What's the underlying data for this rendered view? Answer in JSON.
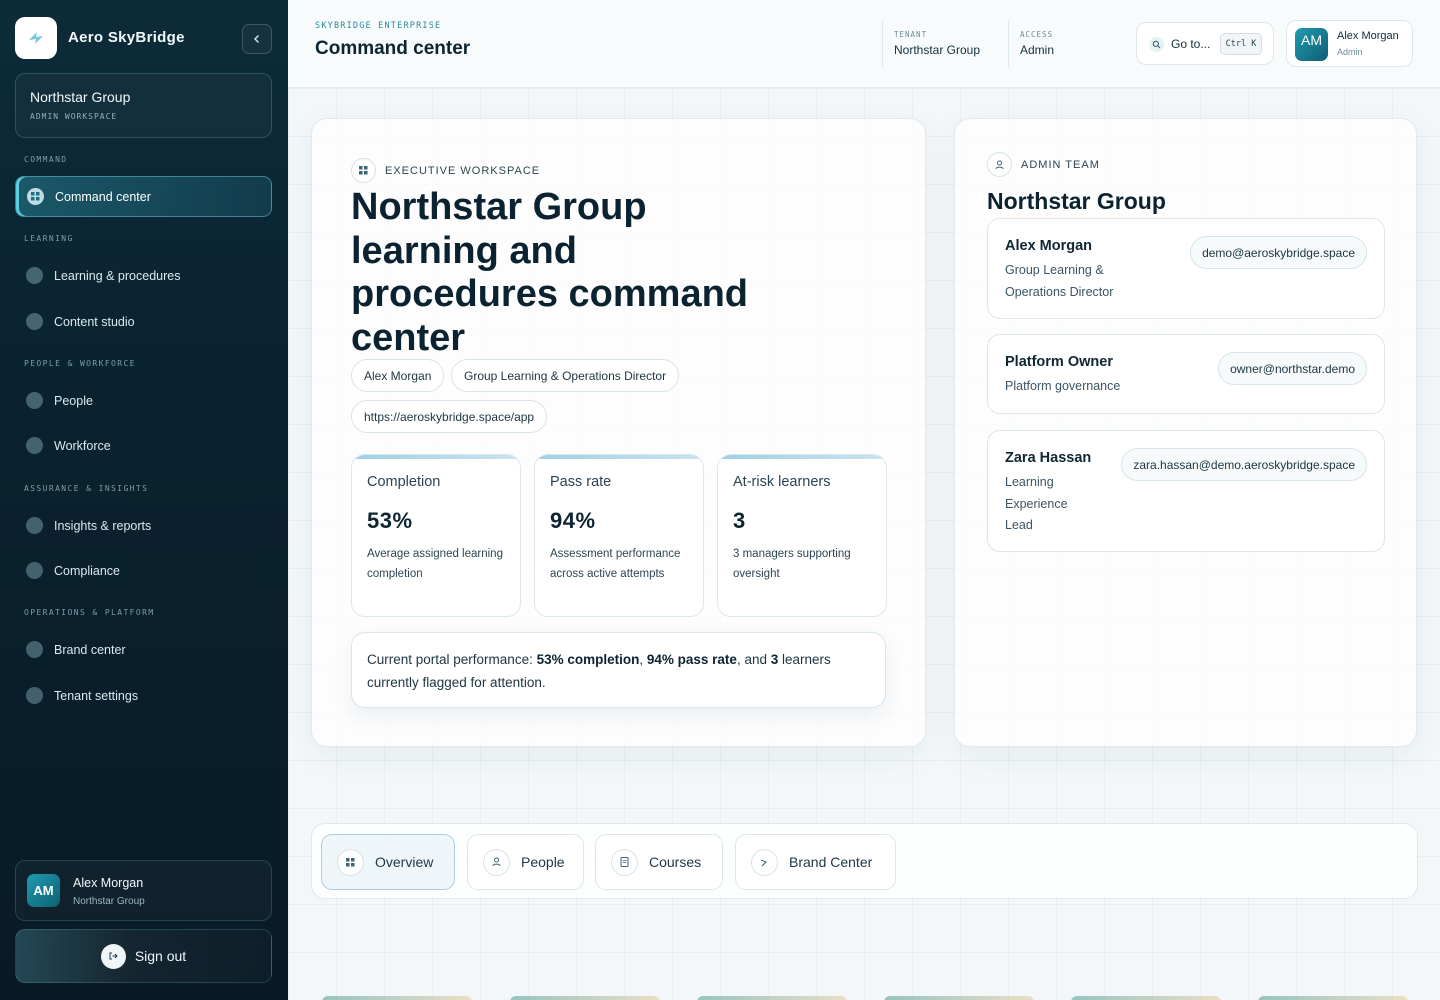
{
  "app": {
    "brand_name": "Aero SkyBridge",
    "workspace_name": "Northstar Group",
    "workspace_label": "ADMIN WORKSPACE"
  },
  "sidebar": {
    "sections": [
      {
        "label": "COMMAND",
        "items": [
          {
            "label": "Command center",
            "icon": "grid-icon",
            "active": true
          }
        ]
      },
      {
        "label": "LEARNING",
        "items": [
          {
            "label": "Learning & procedures",
            "icon": "book-icon"
          },
          {
            "label": "Content studio",
            "icon": "sparkle-icon"
          }
        ]
      },
      {
        "label": "PEOPLE & WORKFORCE",
        "items": [
          {
            "label": "People",
            "icon": "user-icon"
          },
          {
            "label": "Workforce",
            "icon": "team-icon"
          }
        ]
      },
      {
        "label": "ASSURANCE & INSIGHTS",
        "items": [
          {
            "label": "Insights & reports",
            "icon": "bar-chart-icon"
          },
          {
            "label": "Compliance",
            "icon": "shield-check-icon"
          }
        ]
      },
      {
        "label": "OPERATIONS & PLATFORM",
        "items": [
          {
            "label": "Brand center",
            "icon": "brush-icon"
          },
          {
            "label": "Tenant settings",
            "icon": "gear-icon"
          }
        ]
      }
    ],
    "user": {
      "initials": "AM",
      "name": "Alex Morgan",
      "org": "Northstar Group"
    },
    "sign_out_label": "Sign out"
  },
  "header": {
    "eyebrow": "SKYBRIDGE ENTERPRISE",
    "title": "Command center",
    "tenant_label": "TENANT",
    "tenant_value": "Northstar Group",
    "access_label": "ACCESS",
    "access_value": "Admin",
    "search_label": "Go to...",
    "search_shortcut": "Ctrl K",
    "user_initials": "AM",
    "user_name": "Alex Morgan",
    "user_role": "Admin"
  },
  "hero": {
    "eyebrow": "EXECUTIVE WORKSPACE",
    "title": "Northstar Group learning and procedures command center",
    "chips": [
      "Alex Morgan",
      "Group Learning & Operations Director",
      "https://aeroskybridge.space/app"
    ],
    "stats": [
      {
        "label": "Completion",
        "value": "53%",
        "description": "Average assigned learning completion"
      },
      {
        "label": "Pass rate",
        "value": "94%",
        "description": "Assessment performance across active attempts"
      },
      {
        "label": "At-risk learners",
        "value": "3",
        "description": "3 managers supporting oversight"
      }
    ],
    "summary": {
      "prefix": "Current portal performance: ",
      "completion": "53% completion",
      "sep1": ", ",
      "pass_rate": "94% pass rate",
      "sep2": ", and ",
      "at_risk": "3",
      "suffix": " learners currently flagged for attention."
    }
  },
  "admin_team": {
    "eyebrow": "ADMIN TEAM",
    "title": "Northstar Group",
    "members": [
      {
        "name": "Alex Morgan",
        "role": "Group Learning & Operations Director",
        "email": "demo@aeroskybridge.space"
      },
      {
        "name": "Platform Owner",
        "role": "Platform governance",
        "email": "owner@northstar.demo"
      },
      {
        "name": "Zara Hassan",
        "role": "Learning Experience Lead",
        "email": "zara.hassan@demo.aeroskybridge.space"
      }
    ]
  },
  "tabs": [
    {
      "label": "Overview",
      "icon": "grid-icon",
      "active": true
    },
    {
      "label": "People",
      "icon": "user-icon"
    },
    {
      "label": "Courses",
      "icon": "document-icon"
    },
    {
      "label": "Brand Center",
      "icon": "brush-icon"
    }
  ],
  "colors": {
    "sidebar_bg": "#0a2230",
    "accent": "#2a8a9a",
    "active_nav": "#5ad0e0"
  }
}
